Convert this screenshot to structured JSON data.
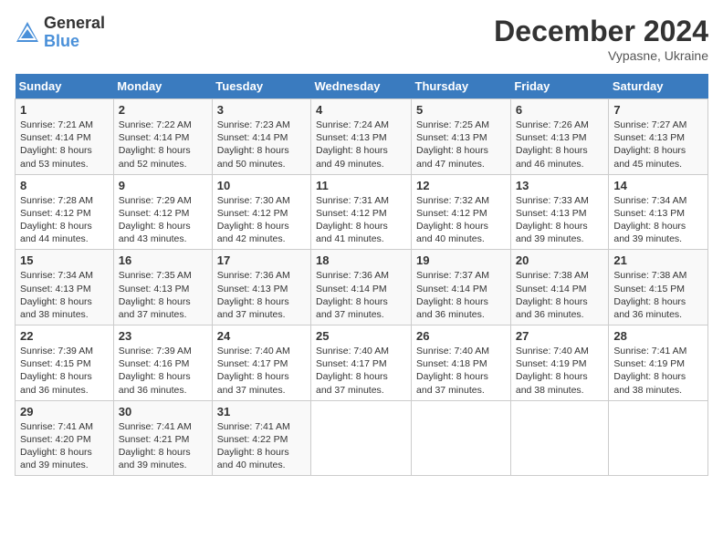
{
  "logo": {
    "general": "General",
    "blue": "Blue"
  },
  "header": {
    "month": "December 2024",
    "location": "Vypasne, Ukraine"
  },
  "days_of_week": [
    "Sunday",
    "Monday",
    "Tuesday",
    "Wednesday",
    "Thursday",
    "Friday",
    "Saturday"
  ],
  "weeks": [
    [
      {
        "day": "1",
        "sunrise": "7:21 AM",
        "sunset": "4:14 PM",
        "daylight": "8 hours and 53 minutes."
      },
      {
        "day": "2",
        "sunrise": "7:22 AM",
        "sunset": "4:14 PM",
        "daylight": "8 hours and 52 minutes."
      },
      {
        "day": "3",
        "sunrise": "7:23 AM",
        "sunset": "4:14 PM",
        "daylight": "8 hours and 50 minutes."
      },
      {
        "day": "4",
        "sunrise": "7:24 AM",
        "sunset": "4:13 PM",
        "daylight": "8 hours and 49 minutes."
      },
      {
        "day": "5",
        "sunrise": "7:25 AM",
        "sunset": "4:13 PM",
        "daylight": "8 hours and 47 minutes."
      },
      {
        "day": "6",
        "sunrise": "7:26 AM",
        "sunset": "4:13 PM",
        "daylight": "8 hours and 46 minutes."
      },
      {
        "day": "7",
        "sunrise": "7:27 AM",
        "sunset": "4:13 PM",
        "daylight": "8 hours and 45 minutes."
      }
    ],
    [
      {
        "day": "8",
        "sunrise": "7:28 AM",
        "sunset": "4:12 PM",
        "daylight": "8 hours and 44 minutes."
      },
      {
        "day": "9",
        "sunrise": "7:29 AM",
        "sunset": "4:12 PM",
        "daylight": "8 hours and 43 minutes."
      },
      {
        "day": "10",
        "sunrise": "7:30 AM",
        "sunset": "4:12 PM",
        "daylight": "8 hours and 42 minutes."
      },
      {
        "day": "11",
        "sunrise": "7:31 AM",
        "sunset": "4:12 PM",
        "daylight": "8 hours and 41 minutes."
      },
      {
        "day": "12",
        "sunrise": "7:32 AM",
        "sunset": "4:12 PM",
        "daylight": "8 hours and 40 minutes."
      },
      {
        "day": "13",
        "sunrise": "7:33 AM",
        "sunset": "4:13 PM",
        "daylight": "8 hours and 39 minutes."
      },
      {
        "day": "14",
        "sunrise": "7:34 AM",
        "sunset": "4:13 PM",
        "daylight": "8 hours and 39 minutes."
      }
    ],
    [
      {
        "day": "15",
        "sunrise": "7:34 AM",
        "sunset": "4:13 PM",
        "daylight": "8 hours and 38 minutes."
      },
      {
        "day": "16",
        "sunrise": "7:35 AM",
        "sunset": "4:13 PM",
        "daylight": "8 hours and 37 minutes."
      },
      {
        "day": "17",
        "sunrise": "7:36 AM",
        "sunset": "4:13 PM",
        "daylight": "8 hours and 37 minutes."
      },
      {
        "day": "18",
        "sunrise": "7:36 AM",
        "sunset": "4:14 PM",
        "daylight": "8 hours and 37 minutes."
      },
      {
        "day": "19",
        "sunrise": "7:37 AM",
        "sunset": "4:14 PM",
        "daylight": "8 hours and 36 minutes."
      },
      {
        "day": "20",
        "sunrise": "7:38 AM",
        "sunset": "4:14 PM",
        "daylight": "8 hours and 36 minutes."
      },
      {
        "day": "21",
        "sunrise": "7:38 AM",
        "sunset": "4:15 PM",
        "daylight": "8 hours and 36 minutes."
      }
    ],
    [
      {
        "day": "22",
        "sunrise": "7:39 AM",
        "sunset": "4:15 PM",
        "daylight": "8 hours and 36 minutes."
      },
      {
        "day": "23",
        "sunrise": "7:39 AM",
        "sunset": "4:16 PM",
        "daylight": "8 hours and 36 minutes."
      },
      {
        "day": "24",
        "sunrise": "7:40 AM",
        "sunset": "4:17 PM",
        "daylight": "8 hours and 37 minutes."
      },
      {
        "day": "25",
        "sunrise": "7:40 AM",
        "sunset": "4:17 PM",
        "daylight": "8 hours and 37 minutes."
      },
      {
        "day": "26",
        "sunrise": "7:40 AM",
        "sunset": "4:18 PM",
        "daylight": "8 hours and 37 minutes."
      },
      {
        "day": "27",
        "sunrise": "7:40 AM",
        "sunset": "4:19 PM",
        "daylight": "8 hours and 38 minutes."
      },
      {
        "day": "28",
        "sunrise": "7:41 AM",
        "sunset": "4:19 PM",
        "daylight": "8 hours and 38 minutes."
      }
    ],
    [
      {
        "day": "29",
        "sunrise": "7:41 AM",
        "sunset": "4:20 PM",
        "daylight": "8 hours and 39 minutes."
      },
      {
        "day": "30",
        "sunrise": "7:41 AM",
        "sunset": "4:21 PM",
        "daylight": "8 hours and 39 minutes."
      },
      {
        "day": "31",
        "sunrise": "7:41 AM",
        "sunset": "4:22 PM",
        "daylight": "8 hours and 40 minutes."
      },
      null,
      null,
      null,
      null
    ]
  ],
  "labels": {
    "sunrise": "Sunrise:",
    "sunset": "Sunset:",
    "daylight": "Daylight:"
  }
}
